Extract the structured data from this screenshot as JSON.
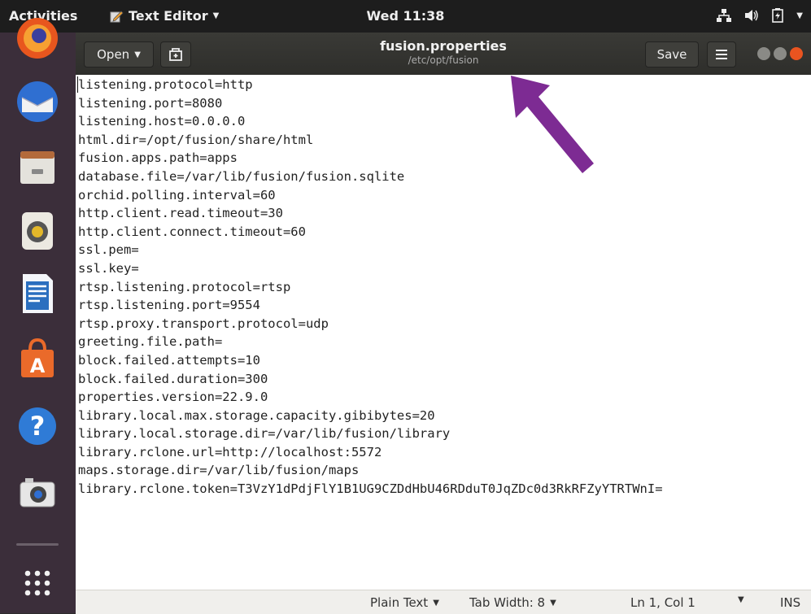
{
  "top_panel": {
    "activities": "Activities",
    "app_menu": "Text Editor",
    "clock": "Wed 11:38"
  },
  "dock": {
    "items": [
      "firefox-icon",
      "thunderbird-icon",
      "files-icon",
      "rhythmbox-icon",
      "libreoffice-writer-icon",
      "software-center-icon",
      "help-icon",
      "screenshot-icon",
      "show-apps-icon"
    ]
  },
  "headerbar": {
    "open_label": "Open",
    "title": "fusion.properties",
    "path": "/etc/opt/fusion",
    "save_label": "Save"
  },
  "editor": {
    "lines": [
      "listening.protocol=http",
      "listening.port=8080",
      "listening.host=0.0.0.0",
      "html.dir=/opt/fusion/share/html",
      "fusion.apps.path=apps",
      "database.file=/var/lib/fusion/fusion.sqlite",
      "orchid.polling.interval=60",
      "http.client.read.timeout=30",
      "http.client.connect.timeout=60",
      "ssl.pem=",
      "ssl.key=",
      "rtsp.listening.protocol=rtsp",
      "rtsp.listening.port=9554",
      "rtsp.proxy.transport.protocol=udp",
      "greeting.file.path=",
      "block.failed.attempts=10",
      "block.failed.duration=300",
      "properties.version=22.9.0",
      "library.local.max.storage.capacity.gibibytes=20",
      "library.local.storage.dir=/var/lib/fusion/library",
      "library.rclone.url=http://localhost:5572",
      "maps.storage.dir=/var/lib/fusion/maps",
      "library.rclone.token=T3VzY1dPdjFlY1B1UG9CZDdHbU46RDduT0JqZDc0d3RkRFZyYTRTWnI="
    ]
  },
  "statusbar": {
    "language": "Plain Text",
    "tab_width": "Tab Width: 8",
    "position": "Ln 1, Col 1",
    "mode": "INS"
  },
  "colors": {
    "arrow": "#7d2b93",
    "dock_bg": "#3b2e3a",
    "close_button": "#e95420"
  }
}
